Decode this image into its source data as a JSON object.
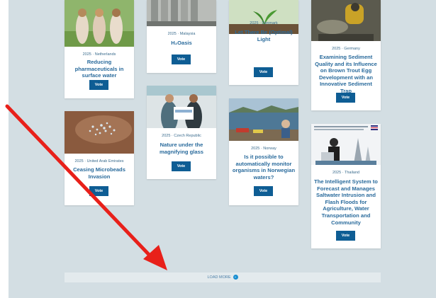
{
  "cards": [
    {
      "meta": "2025 · Netherlands",
      "title": "Reducing pharmaceuticals in surface water",
      "vote": "Vote"
    },
    {
      "meta": "2025 · Malaysia",
      "title": "H₂Oasis",
      "vote": "Vote"
    },
    {
      "meta": "2025 · Denmark",
      "title": "Let There Be (Optimal) Light",
      "vote": "Vote"
    },
    {
      "meta": "2025 · Germany",
      "title": "Examining Sediment Quality and its Influence on Brown Trout Egg Development with an Innovative Sediment Trap",
      "vote": "Vote"
    },
    {
      "meta": "2025 · United Arab Emirates",
      "title": "Ceasing Microbeads Invasion",
      "vote": "Vote"
    },
    {
      "meta": "2025 · Czech Republic",
      "title": "Nature under the magnifying glass",
      "vote": "Vote"
    },
    {
      "meta": "2025 · Norway",
      "title": "Is it possible to automatically monitor organisms in Norwegian waters?",
      "vote": "Vote"
    },
    {
      "meta": "2025 · Thailand",
      "title": "The Intelligent System to Forecast and Manages Saltwater Intrusion and Flash Floods for Agriculture, Water Transportation and Community",
      "vote": "Vote"
    }
  ],
  "load_more": {
    "label": "LOAD MORE",
    "icon": "chevron-down-icon"
  },
  "annotation": {
    "arrow_color": "#e8201a",
    "icon": "red-arrow"
  },
  "colors": {
    "background": "#d3dee3",
    "accent": "#0e5d94",
    "title": "#2a6b9c"
  }
}
